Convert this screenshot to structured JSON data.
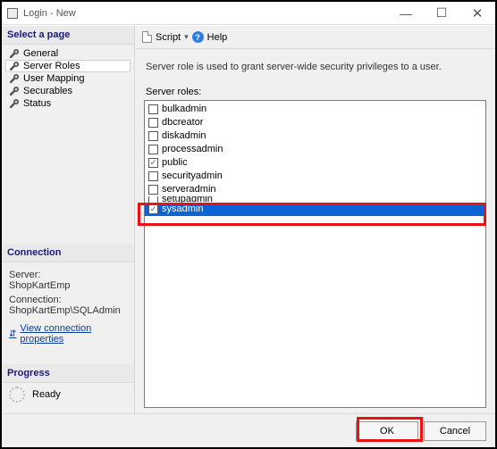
{
  "window": {
    "title": "Login - New"
  },
  "sidebar": {
    "select_page_header": "Select a page",
    "pages": [
      "General",
      "Server Roles",
      "User Mapping",
      "Securables",
      "Status"
    ],
    "selected_page_index": 1,
    "connection_header": "Connection",
    "progress_header": "Progress"
  },
  "connection": {
    "server_label": "Server:",
    "server_value": "ShopKartEmp",
    "connection_label": "Connection:",
    "connection_value": "ShopKartEmp\\SQLAdmin",
    "link_label": "View connection properties"
  },
  "progress": {
    "status": "Ready"
  },
  "toolbar": {
    "script_label": "Script",
    "help_label": "Help"
  },
  "main": {
    "description": "Server role is used to grant server-wide security privileges to a user.",
    "roles_label": "Server roles:",
    "roles": [
      {
        "name": "bulkadmin",
        "checked": false,
        "selected": false
      },
      {
        "name": "dbcreator",
        "checked": false,
        "selected": false
      },
      {
        "name": "diskadmin",
        "checked": false,
        "selected": false
      },
      {
        "name": "processadmin",
        "checked": false,
        "selected": false
      },
      {
        "name": "public",
        "checked": true,
        "selected": false
      },
      {
        "name": "securityadmin",
        "checked": false,
        "selected": false
      },
      {
        "name": "serveradmin",
        "checked": false,
        "selected": false
      },
      {
        "name": "setupadmin",
        "checked": false,
        "selected": false
      },
      {
        "name": "sysadmin",
        "checked": true,
        "selected": true
      }
    ]
  },
  "buttons": {
    "ok": "OK",
    "cancel": "Cancel"
  }
}
